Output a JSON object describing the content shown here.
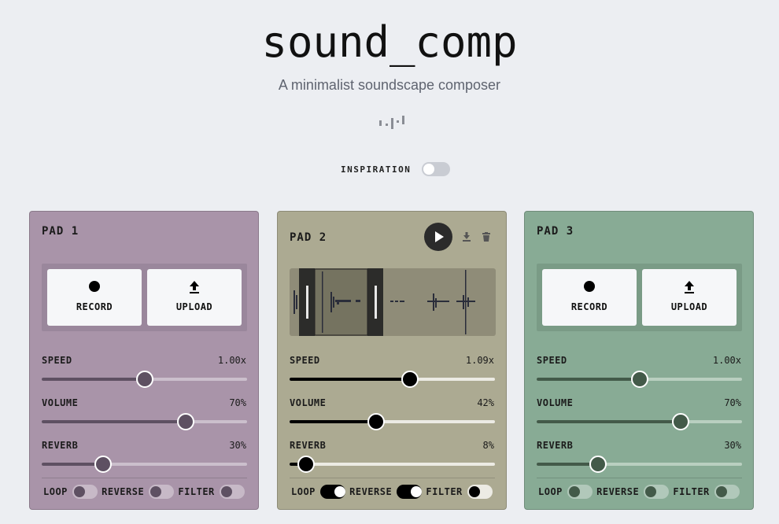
{
  "app": {
    "title": "sound_comp",
    "subtitle": "A minimalist soundscape composer",
    "logo_icon": "waveform-bars-icon"
  },
  "inspiration": {
    "label": "INSPIRATION",
    "on": false
  },
  "pads": [
    {
      "title": "PAD 1",
      "bg": "#a994a9",
      "accent": "#5e5062",
      "record_label": "RECORD",
      "upload_label": "UPLOAD",
      "speed": {
        "label": "SPEED",
        "value": "1.00x",
        "fraction": 0.5
      },
      "volume": {
        "label": "VOLUME",
        "value": "70%",
        "fraction": 0.7
      },
      "reverb": {
        "label": "REVERB",
        "value": "30%",
        "fraction": 0.3
      },
      "toggles": [
        {
          "label": "LOOP",
          "on": false
        },
        {
          "label": "REVERSE",
          "on": false
        },
        {
          "label": "FILTER",
          "on": false
        }
      ]
    },
    {
      "title": "PAD 2",
      "bg": "#acaa92",
      "accent": "#000000",
      "speed": {
        "label": "SPEED",
        "value": "1.09x",
        "fraction": 0.585
      },
      "volume": {
        "label": "VOLUME",
        "value": "42%",
        "fraction": 0.42
      },
      "reverb": {
        "label": "REVERB",
        "value": "8%",
        "fraction": 0.08
      },
      "toggles": [
        {
          "label": "LOOP",
          "on": true
        },
        {
          "label": "REVERSE",
          "on": true
        },
        {
          "label": "FILTER",
          "on": false
        }
      ],
      "icons": {
        "play": "play-icon",
        "download": "download-icon",
        "delete": "trash-icon"
      }
    },
    {
      "title": "PAD 3",
      "bg": "#88ab95",
      "accent": "#435a49",
      "record_label": "RECORD",
      "upload_label": "UPLOAD",
      "speed": {
        "label": "SPEED",
        "value": "1.00x",
        "fraction": 0.5
      },
      "volume": {
        "label": "VOLUME",
        "value": "70%",
        "fraction": 0.7
      },
      "reverb": {
        "label": "REVERB",
        "value": "30%",
        "fraction": 0.3
      },
      "toggles": [
        {
          "label": "LOOP",
          "on": false
        },
        {
          "label": "REVERSE",
          "on": false
        },
        {
          "label": "FILTER",
          "on": false
        }
      ]
    }
  ]
}
